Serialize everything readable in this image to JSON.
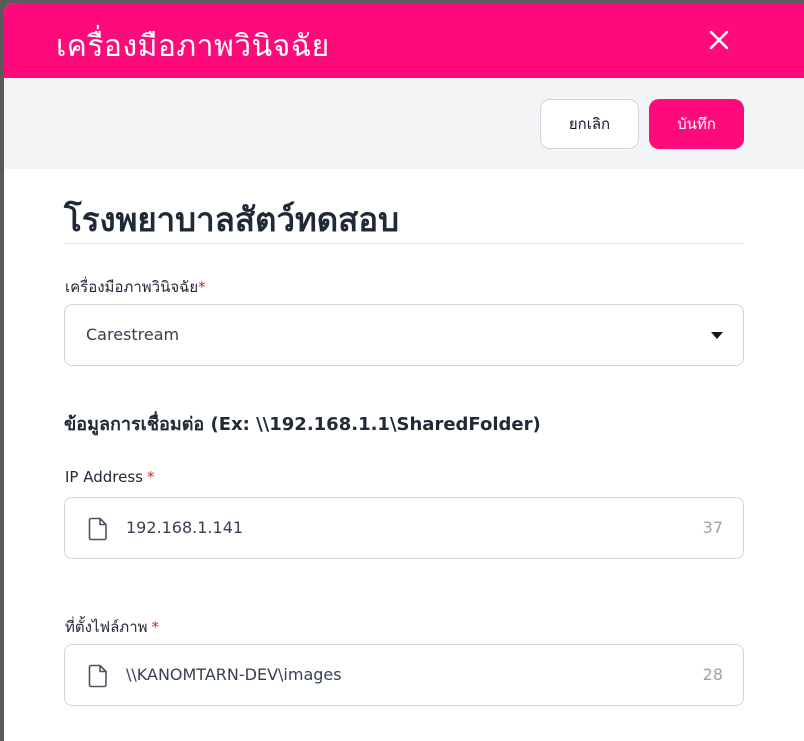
{
  "dialog": {
    "title": "เครื่องมือภาพวินิจฉัย",
    "close_icon": "close-icon",
    "cancel_label": "ยกเลิก",
    "save_label": "บันทึก",
    "accent_color": "#ff0a7a"
  },
  "form": {
    "hospital_name": "โรงพยาบาลสัตว์ทดสอบ",
    "device": {
      "label": "เครื่องมือภาพวินิจฉัย",
      "required_mark": "*",
      "selected": "Carestream"
    },
    "connection_title": "ข้อมูลการเชื่อมต่อ (Ex: \\\\192.168.1.1\\SharedFolder)",
    "ip": {
      "label": "IP Address",
      "required_mark": "*",
      "value": "192.168.1.141",
      "remaining": "37",
      "icon": "file-icon"
    },
    "path": {
      "label": "ที่ตั้งไฟล์ภาพ",
      "required_mark": "*",
      "value": "\\\\KANOMTARN-DEV\\images",
      "remaining": "28",
      "icon": "file-icon"
    }
  }
}
